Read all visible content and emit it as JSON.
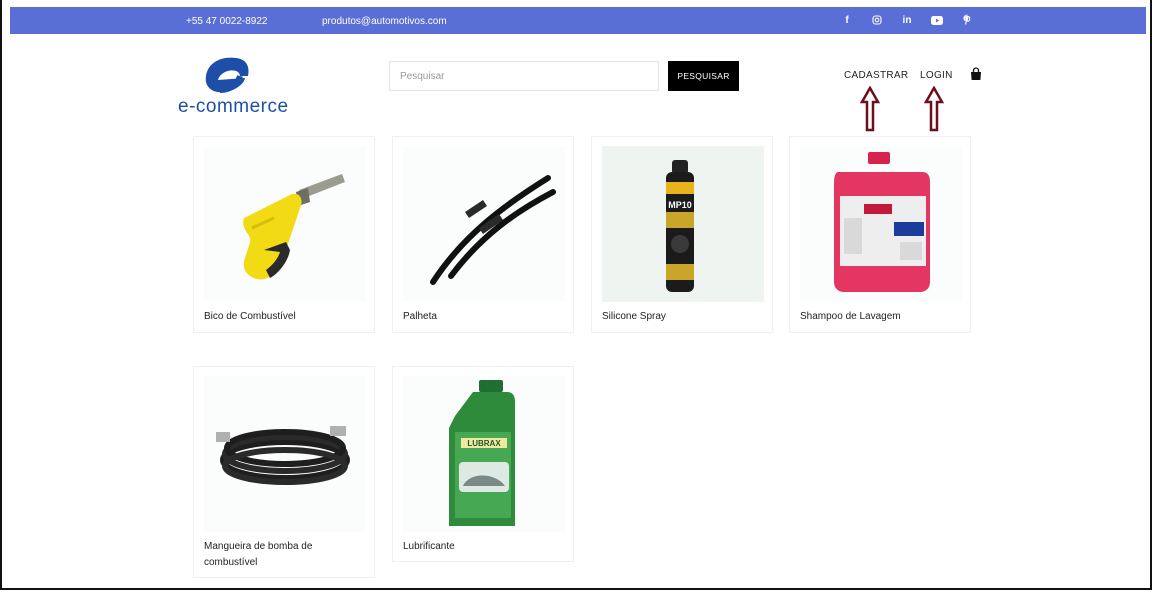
{
  "topbar": {
    "phone": "+55 47 0022-8922",
    "email": "produtos@automotivos.com",
    "social_icons": [
      "facebook-icon",
      "instagram-icon",
      "linkedin-icon",
      "youtube-icon",
      "pinterest-icon"
    ]
  },
  "brand": {
    "name": "e-commerce",
    "color": "#1d4fa8"
  },
  "search": {
    "placeholder": "Pesquisar",
    "button_label": "PESQUISAR"
  },
  "nav": {
    "register_label": "CADASTRAR",
    "login_label": "LOGIN"
  },
  "products": [
    {
      "name": "Bico de Combustível"
    },
    {
      "name": "Palheta"
    },
    {
      "name": "Silicone Spray"
    },
    {
      "name": "Shampoo de Lavagem"
    },
    {
      "name": "Mangueira de bomba de combustível"
    },
    {
      "name": "Lubrificante"
    }
  ],
  "colors": {
    "topbar": "#5a6fd6",
    "button": "#000000",
    "arrow": "#6b0f1a"
  }
}
